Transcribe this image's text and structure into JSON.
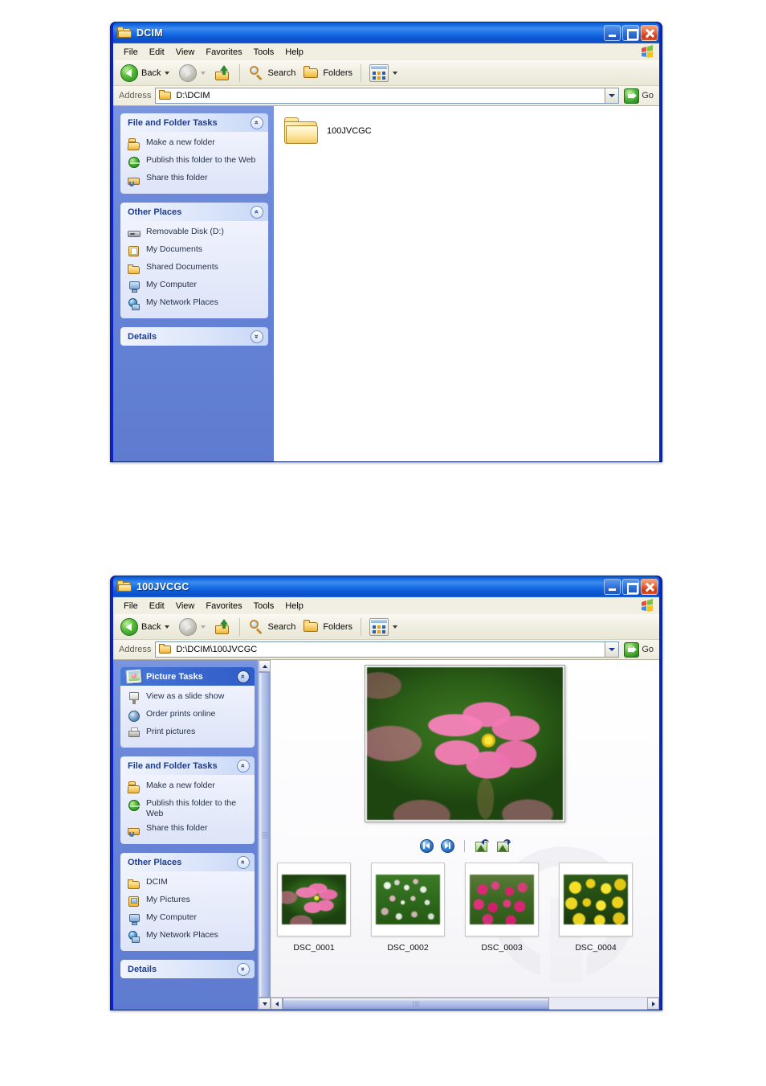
{
  "windows": [
    {
      "id": "dcim",
      "title": "DCIM",
      "menu": [
        "File",
        "Edit",
        "View",
        "Favorites",
        "Tools",
        "Help"
      ],
      "toolbar": {
        "back": "Back",
        "search": "Search",
        "folders": "Folders"
      },
      "address": {
        "label": "Address",
        "value": "D:\\DCIM",
        "go": "Go"
      },
      "panels": [
        {
          "title": "File and Folder Tasks",
          "collapse_icon": "chevron-up-double",
          "items": [
            {
              "label": "Make a new folder",
              "icon": "new-folder-icon"
            },
            {
              "label": "Publish this folder to the Web",
              "icon": "globe-icon"
            },
            {
              "label": "Share this folder",
              "icon": "share-folder-icon"
            }
          ]
        },
        {
          "title": "Other Places",
          "collapse_icon": "chevron-up-double",
          "items": [
            {
              "label": "Removable Disk (D:)",
              "icon": "removable-disk-icon"
            },
            {
              "label": "My Documents",
              "icon": "my-documents-icon"
            },
            {
              "label": "Shared Documents",
              "icon": "shared-documents-icon"
            },
            {
              "label": "My Computer",
              "icon": "my-computer-icon"
            },
            {
              "label": "My Network Places",
              "icon": "my-network-places-icon"
            }
          ]
        },
        {
          "title": "Details",
          "collapse_icon": "chevron-down-double",
          "items": []
        }
      ],
      "content": {
        "folders": [
          {
            "name": "100JVCGC"
          }
        ]
      }
    },
    {
      "id": "jvcgc",
      "title": "100JVCGC",
      "menu": [
        "File",
        "Edit",
        "View",
        "Favorites",
        "Tools",
        "Help"
      ],
      "toolbar": {
        "back": "Back",
        "search": "Search",
        "folders": "Folders"
      },
      "address": {
        "label": "Address",
        "value": "D:\\DCIM\\100JVCGC",
        "go": "Go"
      },
      "panels": [
        {
          "title": "Picture Tasks",
          "collapse_icon": "chevron-up-double",
          "items": [
            {
              "label": "View as a slide show",
              "icon": "slideshow-icon"
            },
            {
              "label": "Order prints online",
              "icon": "order-prints-icon"
            },
            {
              "label": "Print pictures",
              "icon": "printer-icon"
            }
          ]
        },
        {
          "title": "File and Folder Tasks",
          "collapse_icon": "chevron-up-double",
          "items": [
            {
              "label": "Make a new folder",
              "icon": "new-folder-icon"
            },
            {
              "label": "Publish this folder to the Web",
              "icon": "globe-icon"
            },
            {
              "label": "Share this folder",
              "icon": "share-folder-icon"
            }
          ]
        },
        {
          "title": "Other Places",
          "collapse_icon": "chevron-up-double",
          "items": [
            {
              "label": "DCIM",
              "icon": "folder-icon"
            },
            {
              "label": "My Pictures",
              "icon": "my-pictures-icon"
            },
            {
              "label": "My Computer",
              "icon": "my-computer-icon"
            },
            {
              "label": "My Network Places",
              "icon": "my-network-places-icon"
            }
          ]
        },
        {
          "title": "Details",
          "collapse_icon": "chevron-down-double",
          "items": []
        }
      ],
      "filmstrip": {
        "preview_alt": "pink cosmos flower",
        "controls": [
          {
            "name": "previous-image-button",
            "icon": "previous-icon"
          },
          {
            "name": "next-image-button",
            "icon": "next-icon"
          },
          {
            "name": "rotate-counterclockwise-button",
            "icon": "rotate-left-icon"
          },
          {
            "name": "rotate-clockwise-button",
            "icon": "rotate-right-icon"
          }
        ],
        "thumbnails": [
          {
            "label": "DSC_0001"
          },
          {
            "label": "DSC_0002"
          },
          {
            "label": "DSC_0003"
          },
          {
            "label": "DSC_0004"
          }
        ]
      }
    }
  ],
  "glyphs": {
    "chevron_up_double": "«",
    "chevron_down_double": "»"
  },
  "colors": {
    "title_blue": "#0C59D9",
    "sidebar_blue": "#6B87D8",
    "panel_header": "#DCE6FA",
    "panel_body": "#E6EBFA",
    "accent_green": "#2E8B2E",
    "picture_tasks_header": "#3A68CE"
  }
}
